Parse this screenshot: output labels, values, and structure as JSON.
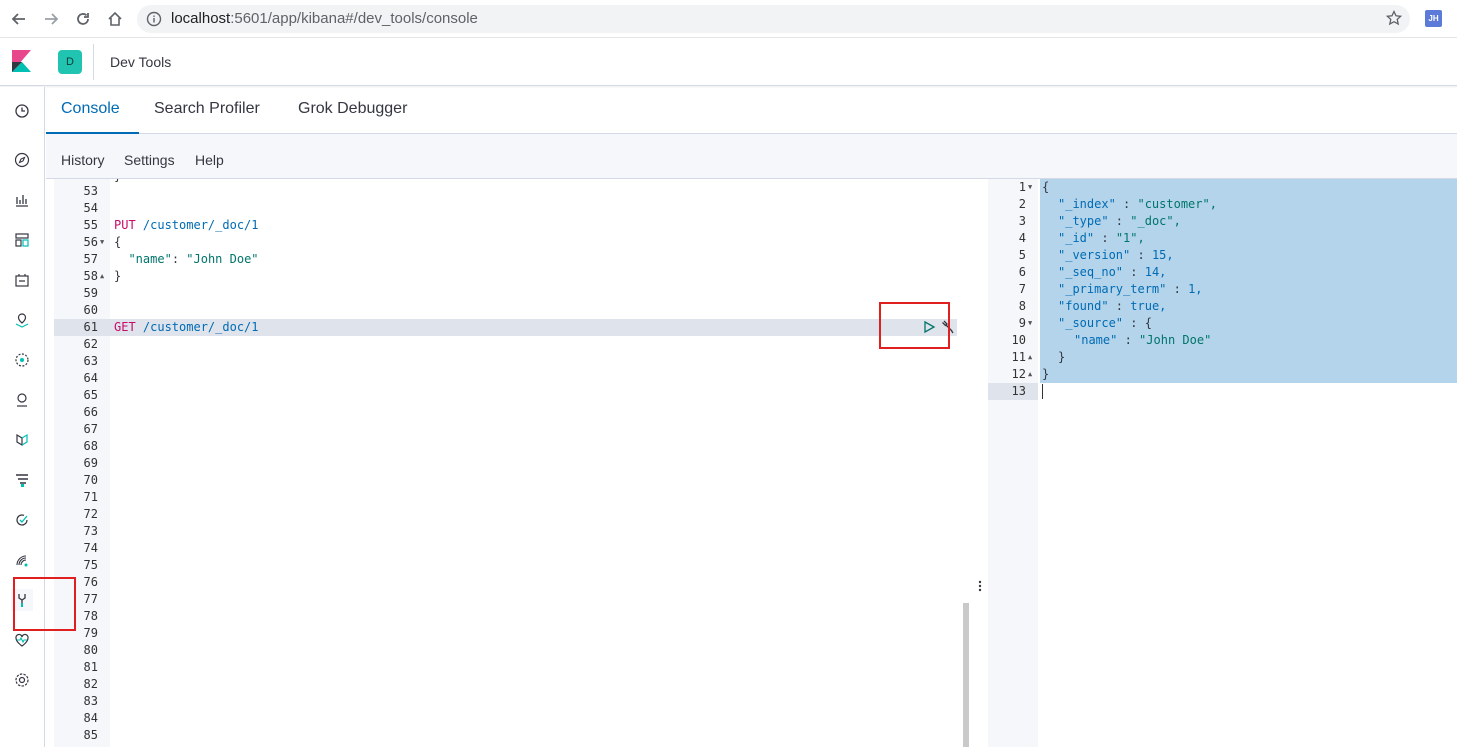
{
  "browser": {
    "url_host": "localhost",
    "url_path": ":5601/app/kibana#/dev_tools/console",
    "profile_initials": "JH"
  },
  "header": {
    "space_initial": "D",
    "app_title": "Dev Tools"
  },
  "tabs": [
    {
      "label": "Console",
      "active": true
    },
    {
      "label": "Search Profiler",
      "active": false
    },
    {
      "label": "Grok Debugger",
      "active": false
    }
  ],
  "console_menu": [
    "History",
    "Settings",
    "Help"
  ],
  "request_editor": {
    "line_numbers": [
      "53",
      "54",
      "55",
      "56",
      "57",
      "58",
      "59",
      "60",
      "61",
      "62",
      "63",
      "64",
      "65",
      "66",
      "67",
      "68",
      "69",
      "70",
      "71",
      "72",
      "73",
      "74",
      "75",
      "76",
      "77",
      "78",
      "79",
      "80",
      "81",
      "82",
      "83",
      "84",
      "85"
    ],
    "put_method": "PUT",
    "put_path": " /customer/_doc/1",
    "open_brace": "{",
    "name_key": "\"name\"",
    "colon": ": ",
    "name_value": "\"John Doe\"",
    "close_brace": "}",
    "get_method": "GET",
    "get_path": " /customer/_doc/1"
  },
  "response_editor": {
    "line_numbers": [
      "1",
      "2",
      "3",
      "4",
      "5",
      "6",
      "7",
      "8",
      "9",
      "10",
      "11",
      "12",
      "13"
    ],
    "lines": [
      {
        "k": "",
        "v": "{"
      },
      {
        "k": "\"_index\"",
        "v": "\"customer\","
      },
      {
        "k": "\"_type\"",
        "v": "\"_doc\","
      },
      {
        "k": "\"_id\"",
        "v": "\"1\","
      },
      {
        "k": "\"_version\"",
        "v": "15,"
      },
      {
        "k": "\"_seq_no\"",
        "v": "14,"
      },
      {
        "k": "\"_primary_term\"",
        "v": "1,"
      },
      {
        "k": "\"found\"",
        "v": "true,"
      },
      {
        "k": "\"_source\"",
        "v": "{"
      },
      {
        "k": "\"name\"",
        "v": "\"John Doe\""
      },
      {
        "k": "",
        "v": "}"
      },
      {
        "k": "",
        "v": "}"
      }
    ],
    "sep": " : "
  },
  "icons": {
    "back": "back-arrow-icon",
    "forward": "forward-arrow-icon",
    "reload": "reload-icon",
    "home": "home-icon",
    "run": "play-icon",
    "settings": "wrench-icon"
  },
  "colors": {
    "accent": "#006bb4",
    "method": "#c80a68",
    "string": "#00756b",
    "highlight": "#e02020"
  }
}
